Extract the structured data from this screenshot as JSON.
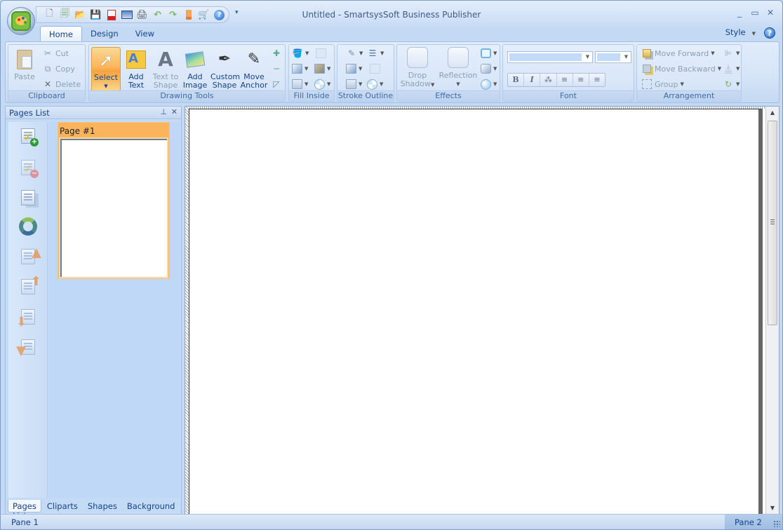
{
  "window": {
    "title": "Untitled - SmartsysSoft Business Publisher",
    "controls": {
      "minimize": "_",
      "maximize": "▭",
      "close": "✕"
    }
  },
  "quick_access": [
    {
      "name": "new-icon",
      "glyph": "🗋"
    },
    {
      "name": "new-from-template-icon",
      "glyph": "🗐"
    },
    {
      "name": "open-folder-icon",
      "glyph": "📂"
    },
    {
      "name": "save-icon",
      "glyph": "💾"
    },
    {
      "name": "export-pdf-icon",
      "glyph": "📕"
    },
    {
      "name": "export-image-icon",
      "glyph": "🖼"
    },
    {
      "name": "print-icon",
      "glyph": "🖨"
    },
    {
      "name": "undo-icon",
      "glyph": "↶"
    },
    {
      "name": "redo-icon",
      "glyph": "↷"
    },
    {
      "name": "clear-icon",
      "glyph": "🧹"
    },
    {
      "name": "buy-cart-icon",
      "glyph": "🛒"
    },
    {
      "name": "help-icon",
      "glyph": "?"
    }
  ],
  "qat_more": "▾",
  "tabs": [
    {
      "label": "Home",
      "active": true
    },
    {
      "label": "Design",
      "active": false
    },
    {
      "label": "View",
      "active": false
    }
  ],
  "style_menu": {
    "label": "Style",
    "arrow": "▼"
  },
  "help": "?",
  "ribbon": {
    "clipboard": {
      "label": "Clipboard",
      "paste": "Paste",
      "cut": "Cut",
      "copy": "Copy",
      "delete": "Delete"
    },
    "drawing_tools": {
      "label": "Drawing Tools",
      "select": "Select",
      "select_arrow": "▼",
      "add_text_1": "Add",
      "add_text_2": "Text",
      "text_to_shape_1": "Text to",
      "text_to_shape_2": "Shape",
      "add_image_1": "Add",
      "add_image_2": "Image",
      "custom_shape_1": "Custom",
      "custom_shape_2": "Shape",
      "move_anchor_1": "Move",
      "move_anchor_2": "Anchor"
    },
    "fill_inside": {
      "label": "Fill Inside"
    },
    "stroke_outline": {
      "label": "Stroke Outline"
    },
    "effects": {
      "label": "Effects",
      "drop_shadow_1": "Drop",
      "drop_shadow_2": "Shadow",
      "reflection": "Reflection"
    },
    "font": {
      "label": "Font",
      "font_name_value": "",
      "font_size_value": "",
      "bold": "B",
      "italic": "I",
      "strike": "⁂",
      "align_left": "≡",
      "align_center": "≡",
      "align_right": "≡"
    },
    "arrangement": {
      "label": "Arrangement",
      "move_forward": "Move Forward",
      "move_backward": "Move Backward",
      "group": "Group"
    }
  },
  "pages_panel": {
    "title": "Pages List",
    "pin": "⊥",
    "close": "✕",
    "tools": [
      "add-page-icon",
      "delete-page-icon",
      "duplicate-page-icon",
      "refresh-icon",
      "move-page-first-icon",
      "move-page-up-icon",
      "move-page-down-icon",
      "move-page-last-icon"
    ],
    "pages": [
      {
        "label": "Page #1",
        "selected": true
      }
    ],
    "tabs": [
      {
        "label": "Pages List",
        "active": true
      },
      {
        "label": "Cliparts",
        "active": false
      },
      {
        "label": "Shapes",
        "active": false
      },
      {
        "label": "Background",
        "active": false
      }
    ]
  },
  "status": {
    "left": "Pane 1",
    "right": "Pane 2"
  }
}
